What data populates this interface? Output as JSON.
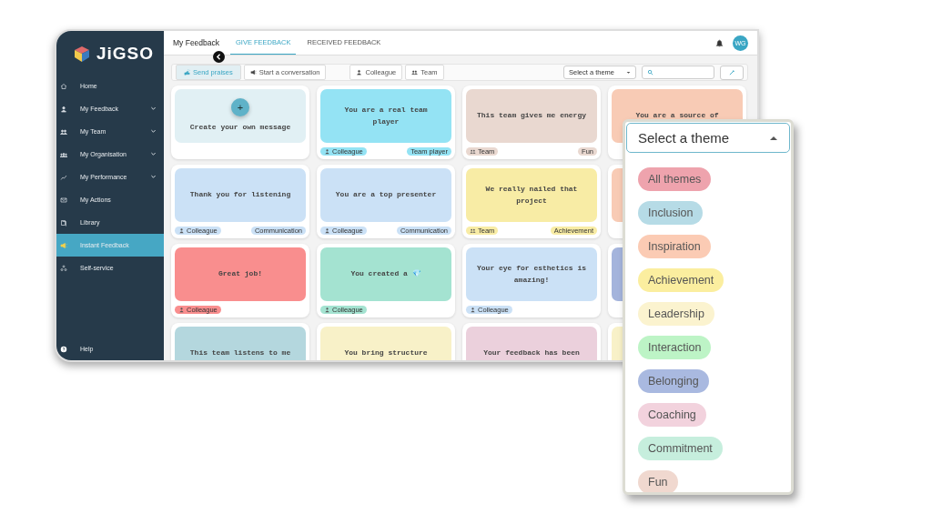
{
  "sidebar": {
    "logo": "JiGSO",
    "items": [
      {
        "label": "Home",
        "expandable": false,
        "selected": false
      },
      {
        "label": "My Feedback",
        "expandable": true,
        "selected": false
      },
      {
        "label": "My Team",
        "expandable": true,
        "selected": false
      },
      {
        "label": "My Organisation",
        "expandable": true,
        "selected": false
      },
      {
        "label": "My Performance",
        "expandable": true,
        "selected": false
      },
      {
        "label": "My Actions",
        "expandable": false,
        "selected": false
      },
      {
        "label": "Library",
        "expandable": false,
        "selected": false
      },
      {
        "label": "Instant Feedback",
        "expandable": false,
        "selected": true
      },
      {
        "label": "Self-service",
        "expandable": false,
        "selected": false
      }
    ],
    "help": "Help"
  },
  "header": {
    "title": "My Feedback",
    "tabs": [
      {
        "label": "GIVE FEEDBACK",
        "selected": true
      },
      {
        "label": "RECEIVED FEEDBACK",
        "selected": false
      }
    ],
    "avatar": "WG"
  },
  "toolbar": {
    "modes": [
      {
        "label": "Send praises",
        "selected": true
      },
      {
        "label": "Start a conversation",
        "selected": false
      }
    ],
    "audience": [
      {
        "kind": "person",
        "label": "Colleague"
      },
      {
        "kind": "team",
        "label": "Team"
      }
    ],
    "theme_select": "Select a theme"
  },
  "cards": [
    {
      "kind": "create",
      "text": "Create your own message",
      "plus": "+",
      "color": "#e1f0f4"
    },
    {
      "kind": "message",
      "text": "You are a real team player",
      "color": "#94e3f4",
      "audience": {
        "kind": "person",
        "label": "Colleague"
      },
      "theme": "Team player"
    },
    {
      "kind": "message",
      "text": "This team gives me energy",
      "color": "#e9d8d0",
      "audience": {
        "kind": "team",
        "label": "Team"
      },
      "theme": "Fun"
    },
    {
      "kind": "message",
      "text": "You are a source of",
      "color": "#f8cbb5"
    },
    {
      "kind": "message",
      "text": "Thank you for listening",
      "color": "#cbe1f6",
      "audience": {
        "kind": "person",
        "label": "Colleague"
      },
      "theme": "Communication"
    },
    {
      "kind": "message",
      "text": "You are a top presenter",
      "color": "#cbe1f6",
      "audience": {
        "kind": "person",
        "label": "Colleague"
      },
      "theme": "Communication"
    },
    {
      "kind": "message",
      "text": "We really nailed that project",
      "color": "#f8eca5",
      "audience": {
        "kind": "team",
        "label": "Team"
      },
      "theme": "Achievement"
    },
    {
      "kind": "message",
      "color": "#f8cbb5"
    },
    {
      "kind": "message",
      "text": "Great job!",
      "color": "#f98e8e",
      "audience": {
        "kind": "person",
        "label": "Colleague"
      }
    },
    {
      "kind": "message",
      "text": "You created a 💎",
      "color": "#a4e3d1",
      "audience": {
        "kind": "person",
        "label": "Colleague"
      }
    },
    {
      "kind": "message",
      "text": "Your eye for esthetics is amazing!",
      "color": "#cbe1f6",
      "audience": {
        "kind": "person",
        "label": "Colleague"
      }
    },
    {
      "kind": "message",
      "color": "#a4b4dc"
    },
    {
      "kind": "message",
      "text": "This team listens to me",
      "color": "#b4d7de"
    },
    {
      "kind": "message",
      "text": "You bring structure",
      "color": "#f8f1c8"
    },
    {
      "kind": "message",
      "text": "Your feedback has been",
      "color": "#ebd0dc"
    },
    {
      "kind": "message",
      "color": "#f8f1c8"
    }
  ],
  "theme_dropdown": {
    "value": "Select a theme",
    "options": [
      {
        "label": "All themes",
        "color": "#eea3ad"
      },
      {
        "label": "Inclusion",
        "color": "#b6dbe6"
      },
      {
        "label": "Inspiration",
        "color": "#fbcbb4"
      },
      {
        "label": "Achievement",
        "color": "#fbee9f"
      },
      {
        "label": "Leadership",
        "color": "#fbf3cf"
      },
      {
        "label": "Interaction",
        "color": "#bdf4c6"
      },
      {
        "label": "Belonging",
        "color": "#a9b9e0"
      },
      {
        "label": "Coaching",
        "color": "#f2d2dd"
      },
      {
        "label": "Commitment",
        "color": "#c6eedd"
      },
      {
        "label": "Fun",
        "color": "#f0d8cf"
      }
    ]
  }
}
